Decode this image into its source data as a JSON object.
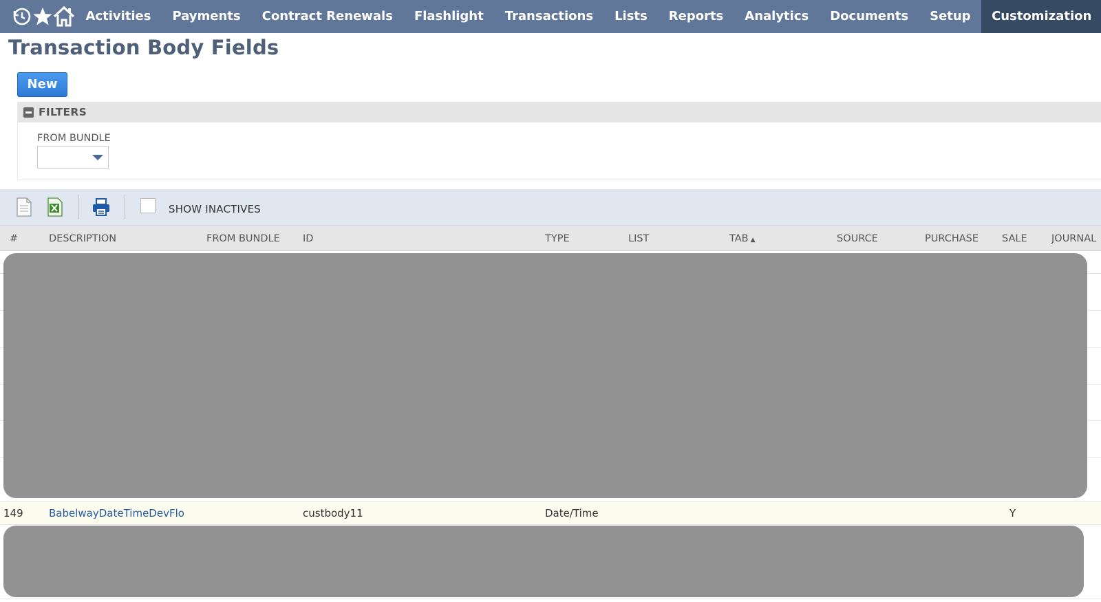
{
  "nav": {
    "items": [
      "Activities",
      "Payments",
      "Contract Renewals",
      "Flashlight",
      "Transactions",
      "Lists",
      "Reports",
      "Analytics",
      "Documents",
      "Setup",
      "Customization"
    ],
    "active": "Customization"
  },
  "page": {
    "title": "Transaction Body Fields"
  },
  "new_button": "New",
  "filters": {
    "title": "FILTERS",
    "from_bundle_label": "FROM BUNDLE",
    "from_bundle_value": ""
  },
  "toolbar": {
    "show_inactives_label": "SHOW INACTIVES"
  },
  "table": {
    "columns": [
      "#",
      "DESCRIPTION",
      "FROM BUNDLE",
      "ID",
      "TYPE",
      "LIST",
      "TAB",
      "SOURCE",
      "PURCHASE",
      "SALE",
      "JOURNAL"
    ],
    "sorted_by": "TAB",
    "visible_row": {
      "number": "149",
      "description": "BabelwayDateTimeDevFlo",
      "from_bundle": "",
      "id": "custbody11",
      "type": "Date/Time",
      "list": "",
      "tab": "",
      "source": "",
      "purchase": "",
      "sale": "Y",
      "journal": ""
    }
  },
  "colors": {
    "nav_bg": "#607799",
    "nav_active_bg": "#364a63",
    "title": "#4d5f79",
    "primary_button": "#3a8ce6",
    "link": "#255aa5",
    "highlight_row": "#fcfcee",
    "redaction": "#929292"
  }
}
